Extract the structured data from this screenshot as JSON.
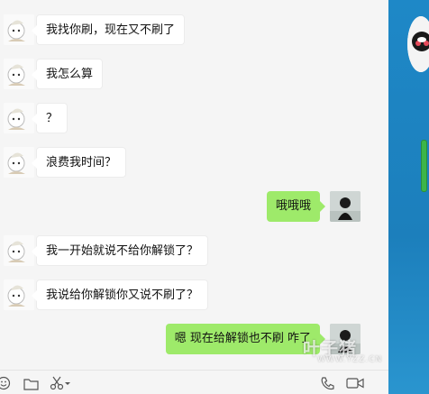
{
  "messages": [
    {
      "side": "left",
      "text": "我找你刷，现在又不刷了"
    },
    {
      "side": "left",
      "text": "我怎么算"
    },
    {
      "side": "left",
      "text": "？"
    },
    {
      "side": "left",
      "text": "浪费我时间？"
    },
    {
      "side": "right",
      "text": "哦哦哦"
    },
    {
      "side": "left",
      "text": "我一开始就说不给你解锁了？"
    },
    {
      "side": "left",
      "text": "我说给你解锁你又说不刷了？"
    },
    {
      "side": "right",
      "text": "嗯 现在给解锁也不刷 咋了"
    }
  ],
  "toolbar": {
    "left_icons": [
      "emoji-icon",
      "folder-icon",
      "scissors-icon"
    ],
    "right_icons": [
      "phone-icon",
      "video-icon"
    ]
  },
  "watermark": {
    "title": "叶子猪",
    "url": "WWW.YZZ.CN"
  },
  "colors": {
    "sent_bubble": "#9eea6a",
    "received_bubble": "#ffffff",
    "sidebar": "#1e88c7"
  }
}
